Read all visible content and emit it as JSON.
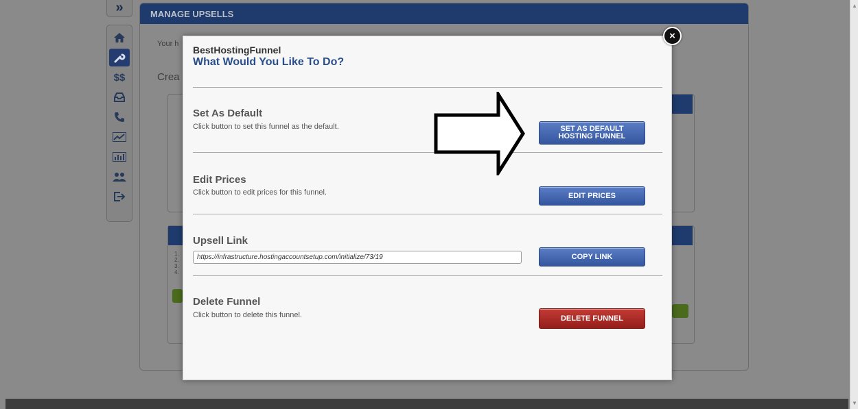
{
  "background": {
    "panel_title": "MANAGE UPSELLS",
    "intro_text_fragment": "Your h",
    "create_text_fragment": "Crea",
    "list_markers": [
      "1.",
      "2.",
      "3.",
      "4."
    ]
  },
  "sidebar": {
    "toggle_icon": "»",
    "money_label": "$$"
  },
  "modal": {
    "funnel_name": "BestHostingFunnel",
    "title": "What Would You Like To Do?",
    "close_symbol": "×",
    "sections": {
      "default": {
        "title": "Set As Default",
        "description": "Click button to set this funnel as the default.",
        "button_line1": "SET AS DEFAULT",
        "button_line2": "HOSTING FUNNEL"
      },
      "prices": {
        "title": "Edit Prices",
        "description": "Click button to edit prices for this funnel.",
        "button": "EDIT PRICES"
      },
      "link": {
        "title": "Upsell Link",
        "url": "https://infrastructure.hostingaccountsetup.com/initialize/73/19",
        "button": "COPY LINK"
      },
      "delete": {
        "title": "Delete Funnel",
        "description": "Click button to delete this funnel.",
        "button": "DELETE FUNNEL"
      }
    }
  },
  "colors": {
    "accent_blue": "#34569f",
    "danger_red": "#951f1b",
    "title_blue": "#2a4e8a"
  }
}
